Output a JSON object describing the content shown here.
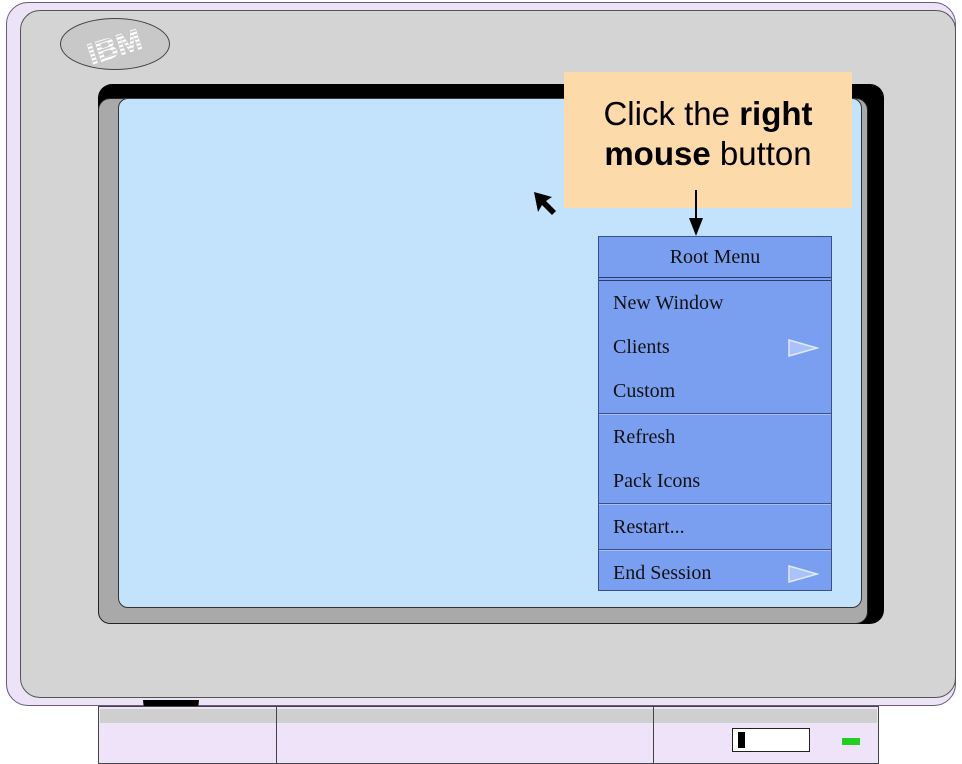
{
  "logo": {
    "text": "IBM",
    "icon": "ibm-logo-icon"
  },
  "callout": {
    "line1_normal": "Click the ",
    "line1_bold": "right",
    "line2_bold": "mouse",
    "line2_normal": " button"
  },
  "menu": {
    "title": "Root Menu",
    "items": [
      {
        "label": "New Window",
        "submenu": false
      },
      {
        "label": "Clients",
        "submenu": true
      },
      {
        "label": "Custom",
        "submenu": false
      },
      {
        "label": "Refresh",
        "submenu": false
      },
      {
        "label": "Pack Icons",
        "submenu": false
      },
      {
        "label": "Restart...",
        "submenu": false
      },
      {
        "label": "End Session",
        "submenu": true
      }
    ]
  },
  "colors": {
    "screen": "#c2e3fb",
    "menu": "#7b9ff0",
    "callout": "#fcdaa9",
    "bezel": "#d4d4d4",
    "power_led": "#1fd01f"
  }
}
